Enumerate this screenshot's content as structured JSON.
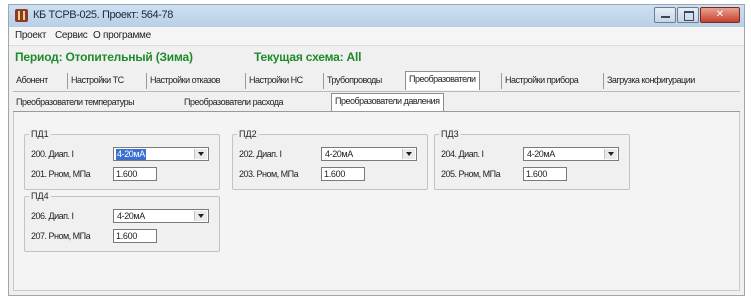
{
  "window": {
    "title": "КБ ТСРВ-025. Проект: 564-78",
    "controls": [
      "minimize",
      "maximize",
      "close"
    ]
  },
  "menu": {
    "items": [
      "Проект",
      "Сервис",
      "О программе"
    ]
  },
  "status": {
    "period": "Период: Отопительный (Зима)",
    "scheme": "Текущая схема: All"
  },
  "tabs": {
    "items": [
      "Абонент",
      "Настройки ТС",
      "Настройки отказов",
      "Настройки НС",
      "Трубопроводы",
      "Преобразователи",
      "Настройки прибора",
      "Загрузка конфигурации"
    ],
    "active": "Преобразователи"
  },
  "subtabs": {
    "items": [
      "Преобразователи температуры",
      "Преобразователи расхода",
      "Преобразователи давления"
    ],
    "active": "Преобразователи давления"
  },
  "sensors": [
    {
      "title": "ПД1",
      "range_label": "200. Диап. I",
      "range_value": "4-20мА",
      "range_selected": true,
      "rnom_label": "201. Рном, МПа",
      "rnom_value": "1.600"
    },
    {
      "title": "ПД2",
      "range_label": "202. Диап. I",
      "range_value": "4-20мА",
      "range_selected": false,
      "rnom_label": "203. Рном, МПа",
      "rnom_value": "1.600"
    },
    {
      "title": "ПД3",
      "range_label": "204. Диап. I",
      "range_value": "4-20мА",
      "range_selected": false,
      "rnom_label": "205. Рном, МПа",
      "rnom_value": "1.600"
    },
    {
      "title": "ПД4",
      "range_label": "206. Диап. I",
      "range_value": "4-20мА",
      "range_selected": false,
      "rnom_label": "207. Рном, МПа",
      "rnom_value": "1.600"
    }
  ],
  "colors": {
    "status_text": "#1e8b2a",
    "selection": "#3b6fd1",
    "titlebar": "#b8cfe6"
  }
}
